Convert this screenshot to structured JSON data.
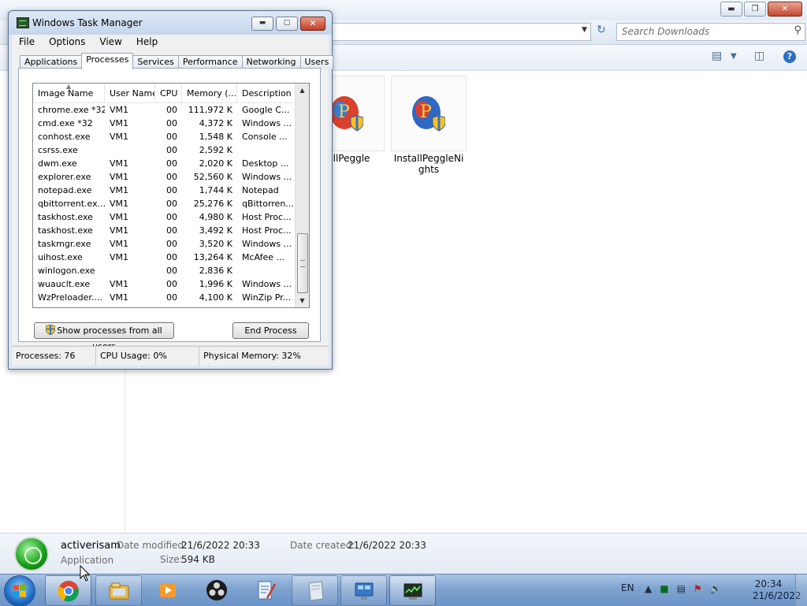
{
  "explorer": {
    "search_placeholder": "Search Downloads",
    "files": [
      {
        "name": "InstallPeggle",
        "display": "tallPeggle"
      },
      {
        "name": "InstallPeggleNights",
        "display": "InstallPeggleNights"
      }
    ],
    "details": {
      "name": "activerisam",
      "type": "Application",
      "date_modified_label": "Date modified:",
      "date_modified": "21/6/2022 20:33",
      "date_created_label": "Date created:",
      "date_created": "21/6/2022 20:33",
      "size_label": "Size:",
      "size": "594 KB"
    }
  },
  "task_manager": {
    "title": "Windows Task Manager",
    "menus": [
      "File",
      "Options",
      "View",
      "Help"
    ],
    "tabs": [
      "Applications",
      "Processes",
      "Services",
      "Performance",
      "Networking",
      "Users"
    ],
    "active_tab": "Processes",
    "columns": [
      "Image Name",
      "User Name",
      "CPU",
      "Memory (...",
      "Description"
    ],
    "processes": [
      {
        "image": "chrome.exe *32",
        "user": "VM1",
        "cpu": "00",
        "memory": "111,972 K",
        "desc": "Google C..."
      },
      {
        "image": "cmd.exe *32",
        "user": "VM1",
        "cpu": "00",
        "memory": "4,372 K",
        "desc": "Windows ..."
      },
      {
        "image": "conhost.exe",
        "user": "VM1",
        "cpu": "00",
        "memory": "1,548 K",
        "desc": "Console ..."
      },
      {
        "image": "csrss.exe",
        "user": "",
        "cpu": "00",
        "memory": "2,592 K",
        "desc": ""
      },
      {
        "image": "dwm.exe",
        "user": "VM1",
        "cpu": "00",
        "memory": "2,020 K",
        "desc": "Desktop ..."
      },
      {
        "image": "explorer.exe",
        "user": "VM1",
        "cpu": "00",
        "memory": "52,560 K",
        "desc": "Windows ..."
      },
      {
        "image": "notepad.exe",
        "user": "VM1",
        "cpu": "00",
        "memory": "1,744 K",
        "desc": "Notepad"
      },
      {
        "image": "qbittorrent.ex...",
        "user": "VM1",
        "cpu": "00",
        "memory": "25,276 K",
        "desc": "qBittorren..."
      },
      {
        "image": "taskhost.exe",
        "user": "VM1",
        "cpu": "00",
        "memory": "4,980 K",
        "desc": "Host Proc..."
      },
      {
        "image": "taskhost.exe",
        "user": "VM1",
        "cpu": "00",
        "memory": "3,492 K",
        "desc": "Host Proc..."
      },
      {
        "image": "taskmgr.exe",
        "user": "VM1",
        "cpu": "00",
        "memory": "3,520 K",
        "desc": "Windows ..."
      },
      {
        "image": "uihost.exe",
        "user": "VM1",
        "cpu": "00",
        "memory": "13,264 K",
        "desc": "McAfee ..."
      },
      {
        "image": "winlogon.exe",
        "user": "",
        "cpu": "00",
        "memory": "2,836 K",
        "desc": ""
      },
      {
        "image": "wuauclt.exe",
        "user": "VM1",
        "cpu": "00",
        "memory": "1,996 K",
        "desc": "Windows ..."
      },
      {
        "image": "WzPreloader....",
        "user": "VM1",
        "cpu": "00",
        "memory": "4,100 K",
        "desc": "WinZip Pr..."
      }
    ],
    "show_all_button": "Show processes from all users",
    "end_process_button": "End Process",
    "status": {
      "processes": "Processes: 76",
      "cpu": "CPU Usage: 0%",
      "memory": "Physical Memory: 32%"
    }
  },
  "taskbar": {
    "apps": [
      "chrome-icon",
      "explorer-icon",
      "media-player-icon",
      "obs-icon",
      "notepad-icon",
      "paper-icon",
      "control-panel-icon",
      "task-manager-icon"
    ],
    "language": "EN",
    "time": "20:34",
    "date": "21/6/2022"
  },
  "colors": {
    "taskbar": "#7fa3cf",
    "tm_frame": "#dce6f3",
    "close_red": "#c23d24"
  }
}
